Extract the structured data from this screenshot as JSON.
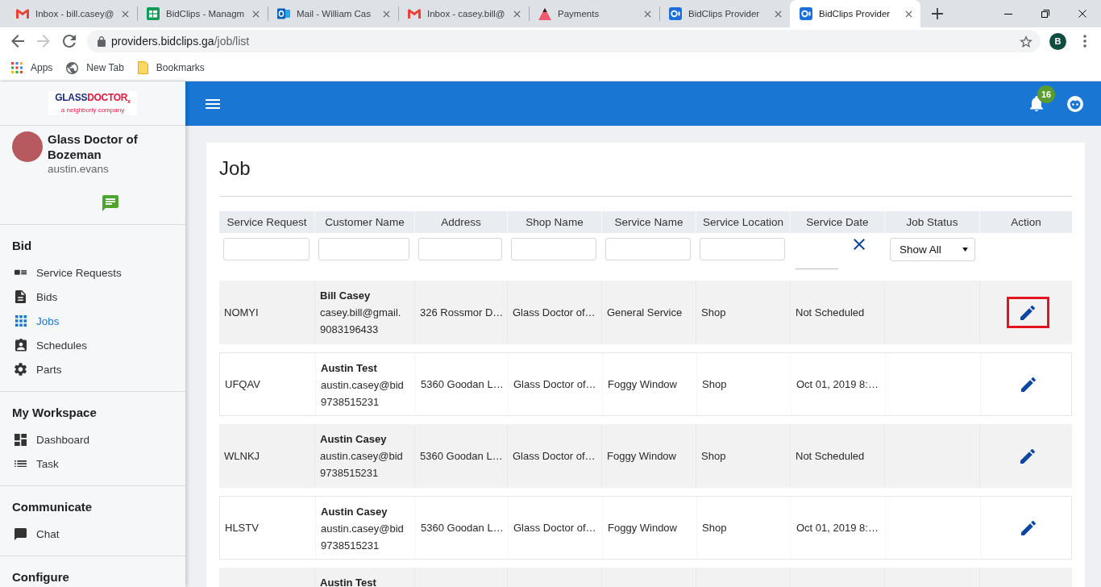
{
  "browser": {
    "tabs": [
      {
        "title": "Inbox - bill.casey@",
        "selected": false
      },
      {
        "title": "BidClips - Managm",
        "selected": false
      },
      {
        "title": "Mail - William Cas",
        "selected": false
      },
      {
        "title": "Inbox - casey.bill@",
        "selected": false
      },
      {
        "title": "Payments",
        "selected": false
      },
      {
        "title": "BidClips Provider",
        "selected": false
      },
      {
        "title": "BidClips Provider",
        "selected": true
      }
    ],
    "forward_disabled": true,
    "address": {
      "host": "providers.bidclips.ga",
      "path": "/job/list"
    },
    "profile_initial": "B",
    "bookmarks": [
      {
        "label": "Apps"
      },
      {
        "label": "New Tab"
      },
      {
        "label": "Bookmarks"
      }
    ]
  },
  "sidebar": {
    "logo": {
      "brand_first": "GLASS",
      "brand_second": "DOCTOR$_{x}$",
      "tagline": "a neighborly company"
    },
    "profile": {
      "name": "Glass Doctor of Bozeman",
      "username": "austin.evans"
    },
    "sections": [
      {
        "title": "Bid",
        "items": [
          {
            "label": "Service Requests",
            "selected": false
          },
          {
            "label": "Bids",
            "selected": false
          },
          {
            "label": "Jobs",
            "selected": true
          },
          {
            "label": "Schedules",
            "selected": false
          },
          {
            "label": "Parts",
            "selected": false
          }
        ]
      },
      {
        "title": "My Workspace",
        "items": [
          {
            "label": "Dashboard",
            "selected": false
          },
          {
            "label": "Task",
            "selected": false
          }
        ]
      },
      {
        "title": "Communicate",
        "items": [
          {
            "label": "Chat",
            "selected": false
          }
        ]
      },
      {
        "title": "Configure"
      }
    ]
  },
  "top_bar": {
    "notification_count": "16"
  },
  "page": {
    "title": "Job",
    "table": {
      "columns": [
        "Service Request",
        "Customer Name",
        "Address",
        "Shop Name",
        "Service Name",
        "Service Location",
        "Service Date",
        "Job Status",
        "Action"
      ],
      "filters": [
        {
          "kind": "text"
        },
        {
          "kind": "text"
        },
        {
          "kind": "text"
        },
        {
          "kind": "text"
        },
        {
          "kind": "text"
        },
        {
          "kind": "text"
        },
        {
          "kind": "date"
        },
        {
          "kind": "select",
          "value": "Show All"
        },
        {
          "kind": "none"
        }
      ],
      "rows": [
        {
          "service_request": "NOMYI",
          "customer_name": "Bill Casey",
          "customer_email": "casey.bill@gmail.",
          "customer_phone": "9083196433",
          "address": "326 Rossmor D…",
          "shop_name": "Glass Doctor of…",
          "service_name": "General Service",
          "service_location": "Shop",
          "service_date": "Not Scheduled",
          "edit_action": true,
          "highlighted": true
        },
        {
          "service_request": "UFQAV",
          "customer_name": "Austin Test",
          "customer_email": "austin.casey@bid",
          "customer_phone": "9738515231",
          "address": "5360 Goodan L…",
          "shop_name": "Glass Doctor of…",
          "service_name": "Foggy Window",
          "service_location": "Shop",
          "service_date": "Oct 01, 2019 8:…",
          "edit_action": true,
          "highlighted": false
        },
        {
          "service_request": "WLNKJ",
          "customer_name": "Austin Casey",
          "customer_email": "austin.casey@bid",
          "customer_phone": "9738515231",
          "address": "5360 Goodan L…",
          "shop_name": "Glass Doctor of…",
          "service_name": "Foggy Window",
          "service_location": "Shop",
          "service_date": "Not Scheduled",
          "edit_action": true,
          "highlighted": false
        },
        {
          "service_request": "HLSTV",
          "customer_name": "Austin Casey",
          "customer_email": "austin.casey@bid",
          "customer_phone": "9738515231",
          "address": "5360 Goodan L…",
          "shop_name": "Glass Doctor of…",
          "service_name": "Foggy Window",
          "service_location": "Shop",
          "service_date": "Oct 01, 2019 8:…",
          "edit_action": true,
          "highlighted": false
        },
        {
          "customer_name": "Austin Test"
        }
      ]
    }
  }
}
